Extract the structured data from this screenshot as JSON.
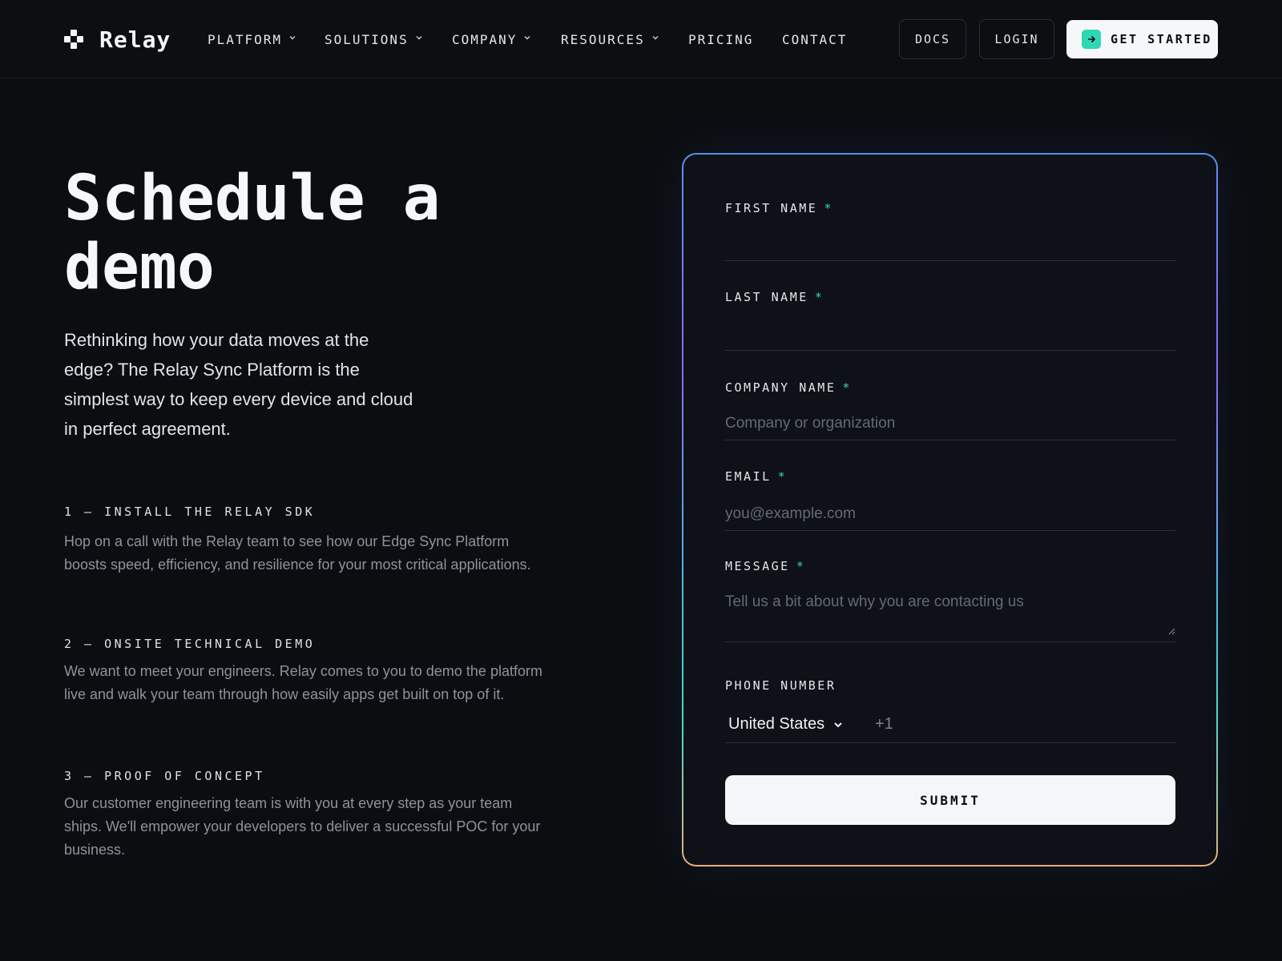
{
  "brand": {
    "name": "Relay"
  },
  "nav": {
    "items": [
      {
        "label": "PLATFORM",
        "dropdown": true
      },
      {
        "label": "SOLUTIONS",
        "dropdown": true
      },
      {
        "label": "COMPANY",
        "dropdown": true
      },
      {
        "label": "RESOURCES",
        "dropdown": true
      },
      {
        "label": "PRICING",
        "dropdown": false
      },
      {
        "label": "CONTACT",
        "dropdown": false
      }
    ],
    "docs": "DOCS",
    "login": "LOGIN",
    "get_started": "GET STARTED"
  },
  "hero": {
    "title_line1": "Schedule a",
    "title_line2": "demo",
    "lead": "Rethinking how your data moves at the edge? The Relay Sync Platform is the simplest way to keep every device and cloud in perfect agreement."
  },
  "steps": [
    {
      "title": "1 — INSTALL THE RELAY SDK",
      "desc": "Hop on a call with the Relay team to see how our Edge Sync Platform boosts speed, efficiency, and resilience for your most critical applications."
    },
    {
      "title": "2 — ONSITE TECHNICAL DEMO",
      "desc": "We want to meet your engineers. Relay comes to you to demo the platform live and walk your team through how easily apps get built on top of it."
    },
    {
      "title": "3 — PROOF OF CONCEPT",
      "desc": "Our customer engineering team is with you at every step as your team ships. We'll empower your developers to deliver a successful POC for your business."
    }
  ],
  "form": {
    "first_name": {
      "label": "FIRST NAME",
      "required": "*",
      "value": "",
      "placeholder": ""
    },
    "last_name": {
      "label": "LAST NAME",
      "required": "*",
      "value": "",
      "placeholder": ""
    },
    "company": {
      "label": "COMPANY NAME",
      "required": "*",
      "value": "",
      "placeholder": "Company or organization"
    },
    "email": {
      "label": "EMAIL",
      "required": "*",
      "value": "",
      "placeholder": "you@example.com"
    },
    "message": {
      "label": "MESSAGE",
      "required": "*",
      "value": "",
      "placeholder": "Tell us a bit about why you are contacting us"
    },
    "phone": {
      "label": "PHONE NUMBER",
      "country": "United States",
      "dial_code": "+1",
      "value": ""
    },
    "submit": "SUBMIT"
  },
  "colors": {
    "background": "#0b0d11",
    "accent": "#2ed8b4",
    "button_light": "#f4f6f8"
  },
  "icons": {
    "logo": "relay-logo-icon",
    "nav_dropdown": "chevron-down-icon",
    "get_started": "arrow-right-icon",
    "country_select": "chevron-down-icon"
  }
}
